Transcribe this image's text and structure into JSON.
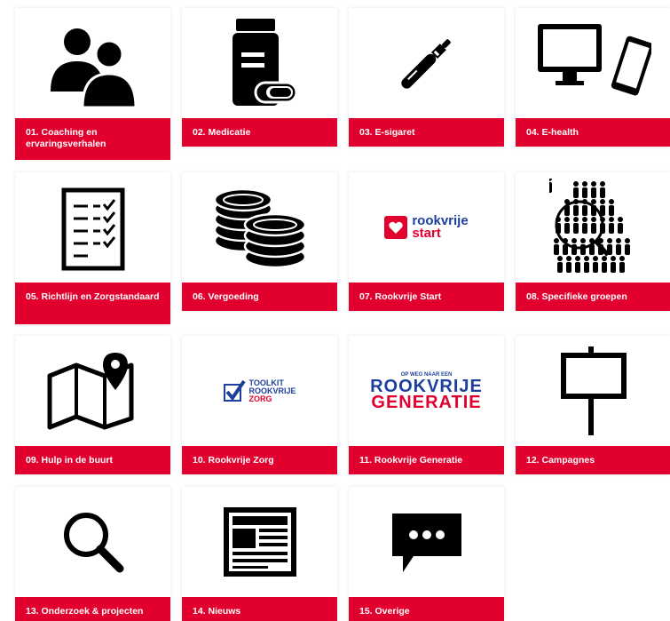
{
  "tiles": [
    {
      "label": "01. Coaching en ervaringsverhalen",
      "icon": "users-icon"
    },
    {
      "label": "02. Medicatie",
      "icon": "medicine-bottle-icon"
    },
    {
      "label": "03. E-sigaret",
      "icon": "e-cigarette-icon"
    },
    {
      "label": "04. E-health",
      "icon": "monitor-phone-icon"
    },
    {
      "label": "05. Richtlijn en Zorgstandaard",
      "icon": "checklist-icon"
    },
    {
      "label": "06. Vergoeding",
      "icon": "coins-icon"
    },
    {
      "label": "07. Rookvrije Start",
      "icon": "rookvrije-start-logo"
    },
    {
      "label": "08. Specifieke groepen",
      "icon": "crowd-magnifier-icon"
    },
    {
      "label": "09. Hulp in de buurt",
      "icon": "map-pin-icon"
    },
    {
      "label": "10. Rookvrije Zorg",
      "icon": "toolkit-rookvrije-zorg-logo"
    },
    {
      "label": "11. Rookvrije Generatie",
      "icon": "rookvrije-generatie-logo"
    },
    {
      "label": "12. Campagnes",
      "icon": "signboard-icon"
    },
    {
      "label": "13. Onderzoek & projecten",
      "icon": "search-icon"
    },
    {
      "label": "14. Nieuws",
      "icon": "newspaper-icon"
    },
    {
      "label": "15. Overige",
      "icon": "chat-bubble-icon"
    }
  ],
  "logos": {
    "rookvrije_start": [
      "rookvrije",
      "start"
    ],
    "toolkit": [
      "TOOLKIT",
      "ROOKVRIJE",
      "ZORG"
    ],
    "generatie": [
      "OP WEG NAAR EEN",
      "ROOKVRIJE",
      "GENERATIE"
    ]
  },
  "colors": {
    "accent": "#e2002e",
    "logo_blue": "#1e3f9c",
    "logo_red": "#e2002e"
  }
}
